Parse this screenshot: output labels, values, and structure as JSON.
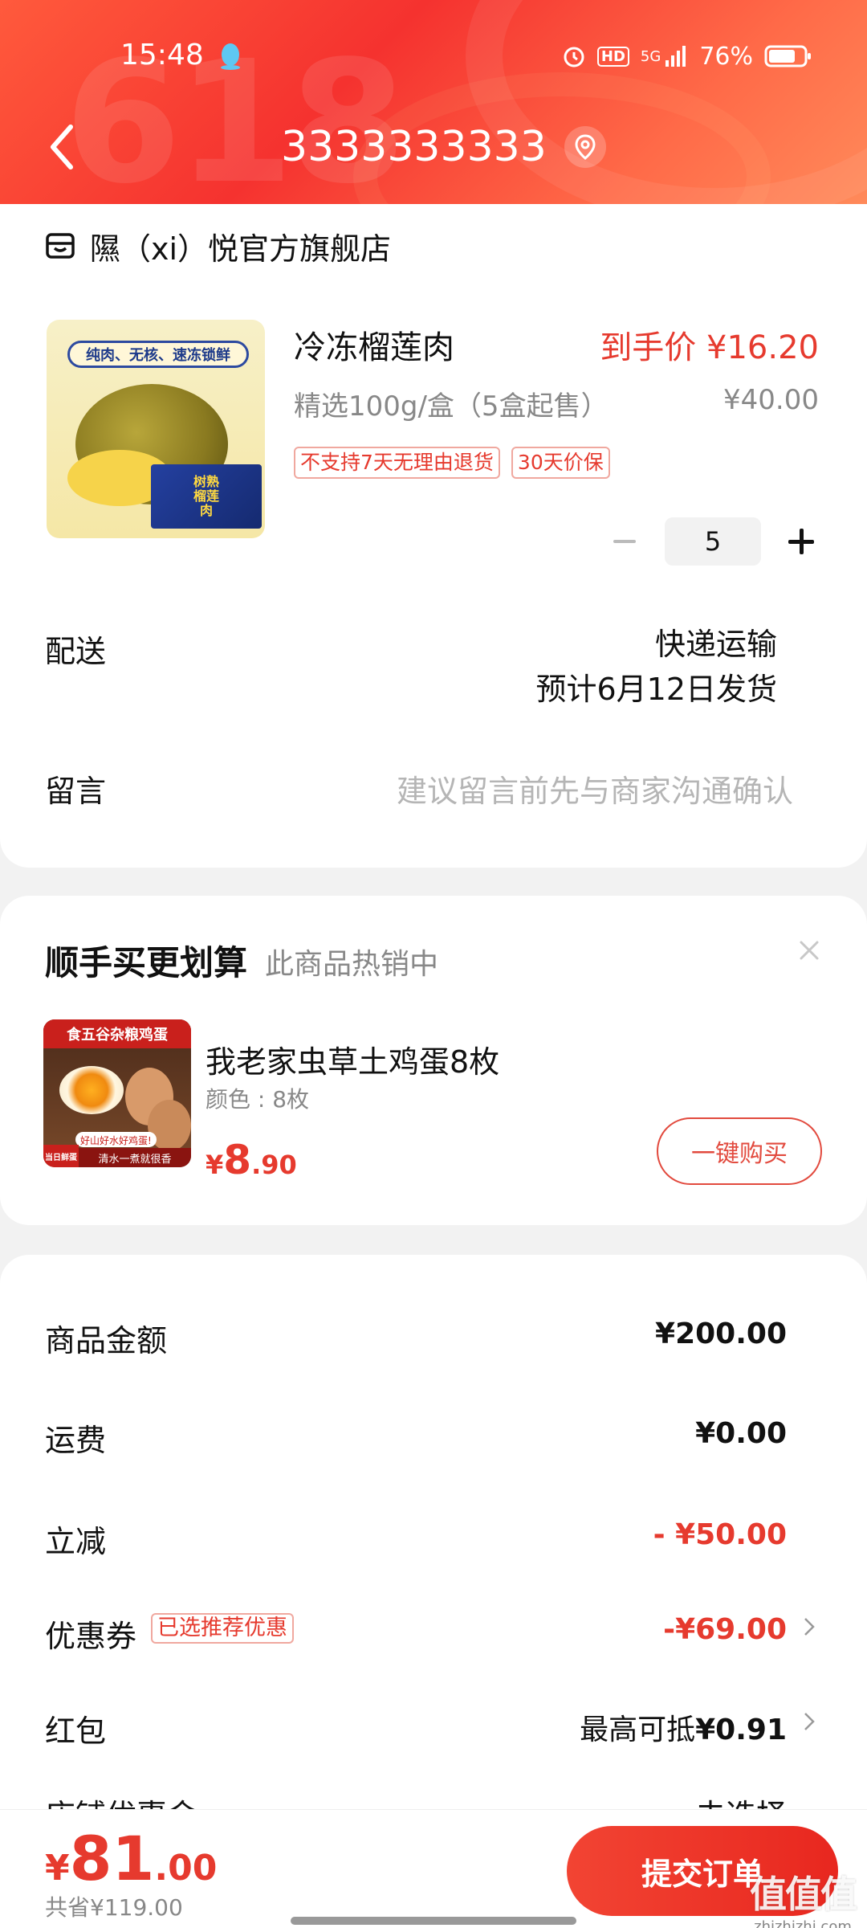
{
  "status_bar": {
    "time": "15:48",
    "battery": "76%",
    "network": "5G",
    "hd": "HD"
  },
  "header": {
    "deco_text": "618",
    "address_title": "3333333333"
  },
  "shop": {
    "name": "隰（xi）悦官方旗舰店"
  },
  "product": {
    "name": "冷冻榴莲肉",
    "final_price": "到手价 ¥16.20",
    "spec": "精选100g/盒（5盒起售）",
    "original_price": "¥40.00",
    "tags": [
      "不支持7天无理由退货",
      "30天价保"
    ],
    "quantity": "5",
    "image_banner": "纯肉、无核、速冻锁鲜",
    "image_box": "树熟榴莲肉"
  },
  "delivery": {
    "label": "配送",
    "method": "快递运输",
    "eta": "预计6月12日发货"
  },
  "note": {
    "label": "留言",
    "placeholder": "建议留言前先与商家沟通确认"
  },
  "recommend": {
    "title": "顺手买更划算",
    "subtitle": "此商品热销中",
    "item_name": "我老家虫草土鸡蛋8枚",
    "item_color": "颜色 : 8枚",
    "price_yen": "¥",
    "price_int": "8",
    "price_dec": ".90",
    "buy_label": "一键购买",
    "image_top": "食五谷杂粮鸡蛋",
    "image_badge": "当日鲜蛋",
    "image_bottom": "清水一煮就很香",
    "image_tag": "好山好水好鸡蛋!"
  },
  "summary": {
    "goods_label": "商品金额",
    "goods_value": "¥200.00",
    "shipping_label": "运费",
    "shipping_value": "¥0.00",
    "discount_label": "立减",
    "discount_value": "- ¥50.00",
    "coupon_label": "优惠券",
    "coupon_badge": "已选推荐优惠",
    "coupon_value": "-¥69.00",
    "redpack_label": "红包",
    "redpack_prefix": "最高可抵",
    "redpack_value": "¥0.91",
    "partial_label": "店铺优惠金",
    "partial_value": "去选择"
  },
  "bottom": {
    "yen": "¥",
    "total_int": "81",
    "total_dec": ".00",
    "saved": "共省¥119.00",
    "submit_label": "提交订单"
  },
  "watermark": {
    "logo": "值值值",
    "url": "zhizhizhi.com"
  },
  "colors": {
    "accent_red": "#e63a2e",
    "header_red": "#f5322f",
    "muted_gray": "#888888"
  }
}
